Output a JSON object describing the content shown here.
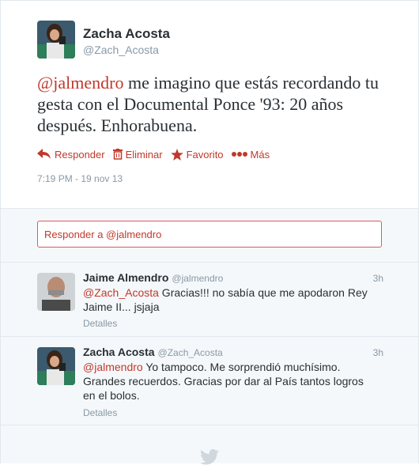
{
  "main_tweet": {
    "author_name": "Zacha Acosta",
    "author_handle": "@Zach_Acosta",
    "mention": "@jalmendro",
    "text": " me imagino que estás recordando tu gesta con el Documental Ponce '93: 20 años después. Enhorabuena.",
    "actions": {
      "reply": "Responder",
      "delete": "Eliminar",
      "favorite": "Favorito",
      "more": "Más"
    },
    "timestamp": "7:19 PM - 19 nov 13"
  },
  "reply_box": {
    "placeholder": "Responder a @jalmendro"
  },
  "replies": [
    {
      "author_name": "Jaime Almendro",
      "author_handle": "@jalmendro",
      "time": "3h",
      "mention": "@Zach_Acosta",
      "text": " Gracias!!! no sabía que me apodaron Rey Jaime II... jsjaja",
      "details": "Detalles"
    },
    {
      "author_name": "Zacha Acosta",
      "author_handle": "@Zach_Acosta",
      "time": "3h",
      "mention": "@jalmendro",
      "text": " Yo tampoco. Me sorprendió muchísimo. Grandes recuerdos. Gracias por dar al País tantos logros en el bolos.",
      "details": "Detalles"
    }
  ],
  "colors": {
    "accent": "#c0392b",
    "muted": "#8899a6",
    "text": "#292f33",
    "bird": "#cfd8de"
  },
  "icons": {
    "reply": "reply-arrow-icon",
    "delete": "trash-icon",
    "favorite": "star-icon",
    "more": "ellipsis-icon",
    "footer": "twitter-bird-icon"
  }
}
